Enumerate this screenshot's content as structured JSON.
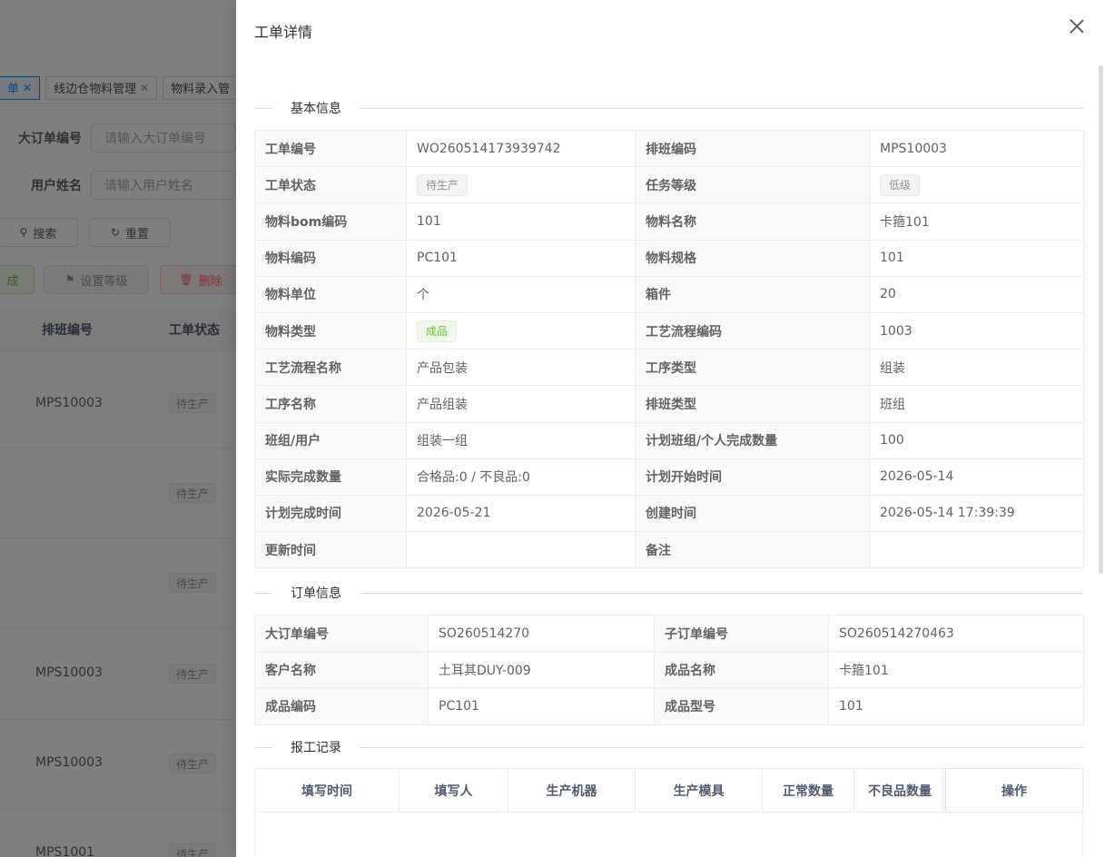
{
  "background": {
    "tabs": [
      {
        "label": "单",
        "active": true
      },
      {
        "label": "线边仓物料管理",
        "active": false
      },
      {
        "label": "物料录入管",
        "active": false
      }
    ],
    "search_form": {
      "order_no_label": "大订单编号",
      "order_no_placeholder": "请输入大订单编号",
      "user_name_label": "用户姓名",
      "user_name_placeholder": "请输入用户姓名"
    },
    "buttons": {
      "search": "搜索",
      "reset": "重置",
      "generate": "成",
      "set_level": "设置等级",
      "delete": "删除"
    },
    "table": {
      "headers": [
        "排班编号",
        "工单状态"
      ],
      "rows": [
        {
          "schedule_no": "MPS10003",
          "status": "待生产"
        },
        {
          "schedule_no": "",
          "status": "待生产"
        },
        {
          "schedule_no": "",
          "status": "待生产"
        },
        {
          "schedule_no": "MPS10003",
          "status": "待生产"
        },
        {
          "schedule_no": "MPS10003",
          "status": "待生产"
        },
        {
          "schedule_no": "MPS1001",
          "status": "待生产"
        }
      ]
    }
  },
  "drawer": {
    "title": "工单详情",
    "sections": {
      "basic": "基本信息",
      "order": "订单信息",
      "report": "报工记录"
    },
    "basic_info": [
      [
        {
          "label": "工单编号",
          "value": "WO260514173939742"
        },
        {
          "label": "排班编码",
          "value": "MPS10003"
        }
      ],
      [
        {
          "label": "工单状态",
          "value": "待生产",
          "tag": "info"
        },
        {
          "label": "任务等级",
          "value": "低级",
          "tag": "info"
        }
      ],
      [
        {
          "label": "物料bom编码",
          "value": "101"
        },
        {
          "label": "物料名称",
          "value": "卡箍101"
        }
      ],
      [
        {
          "label": "物料编码",
          "value": "PC101"
        },
        {
          "label": "物料规格",
          "value": "101"
        }
      ],
      [
        {
          "label": "物料单位",
          "value": "个"
        },
        {
          "label": "箱件",
          "value": "20"
        }
      ],
      [
        {
          "label": "物料类型",
          "value": "成品",
          "tag": "success"
        },
        {
          "label": "工艺流程编码",
          "value": "1003"
        }
      ],
      [
        {
          "label": "工艺流程名称",
          "value": "产品包装"
        },
        {
          "label": "工序类型",
          "value": "组装"
        }
      ],
      [
        {
          "label": "工序名称",
          "value": "产品组装"
        },
        {
          "label": "排班类型",
          "value": "班组"
        }
      ],
      [
        {
          "label": "班组/用户",
          "value": "组装一组"
        },
        {
          "label": "计划班组/个人完成数量",
          "value": "100"
        }
      ],
      [
        {
          "label": "实际完成数量",
          "value": "合格品:0 / 不良品:0"
        },
        {
          "label": "计划开始时间",
          "value": "2026-05-14"
        }
      ],
      [
        {
          "label": "计划完成时间",
          "value": "2026-05-21"
        },
        {
          "label": "创建时间",
          "value": "2026-05-14 17:39:39"
        }
      ],
      [
        {
          "label": "更新时间",
          "value": ""
        },
        {
          "label": "备注",
          "value": ""
        }
      ]
    ],
    "order_info": [
      [
        {
          "label": "大订单编号",
          "value": "SO260514270"
        },
        {
          "label": "子订单编号",
          "value": "SO260514270463"
        }
      ],
      [
        {
          "label": "客户名称",
          "value": "土耳其DUY-009"
        },
        {
          "label": "成品名称",
          "value": "卡箍101"
        }
      ],
      [
        {
          "label": "成品编码",
          "value": "PC101"
        },
        {
          "label": "成品型号",
          "value": "101"
        }
      ]
    ],
    "report_table": {
      "headers": [
        "填写时间",
        "填写人",
        "生产机器",
        "生产模具",
        "正常数量",
        "不良品数量",
        "操作"
      ]
    }
  }
}
